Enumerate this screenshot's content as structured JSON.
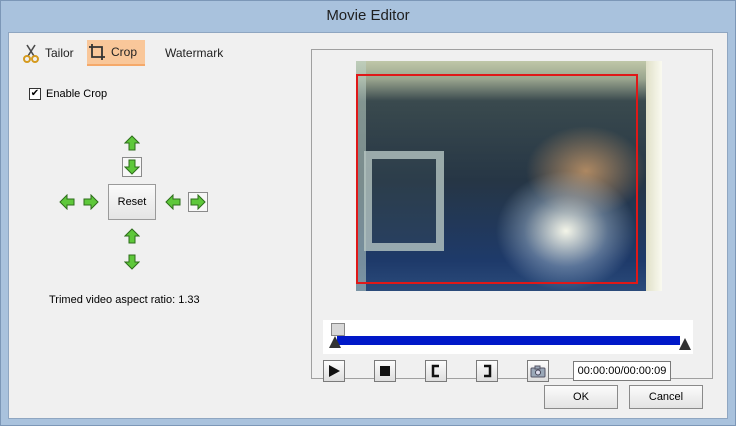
{
  "window": {
    "title": "Movie Editor"
  },
  "tabs": [
    {
      "label": "Tailor",
      "icon": "scissors-icon"
    },
    {
      "label": "Crop",
      "icon": "crop-icon"
    },
    {
      "label": "Watermark",
      "icon": "watermark-icon"
    }
  ],
  "crop": {
    "enable_label": "Enable Crop",
    "enabled": true,
    "reset_label": "Reset",
    "aspect_text": "Trimed video aspect ratio: 1.33"
  },
  "player": {
    "time_display": "00:00:00/00:00:09"
  },
  "dialog": {
    "ok_label": "OK",
    "cancel_label": "Cancel"
  },
  "colors": {
    "titlebar": "#a9c2dd",
    "crop_rect": "#e01818",
    "timeline_bar": "#0018c8",
    "arrow_green": "#5ec83a",
    "active_tab": "#f9c79a"
  }
}
